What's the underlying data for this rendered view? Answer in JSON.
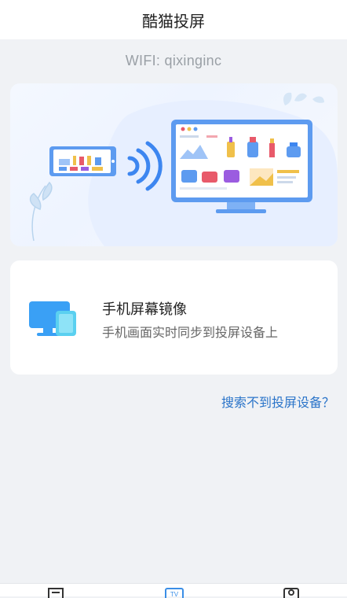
{
  "header": {
    "title": "酷猫投屏"
  },
  "wifi": {
    "text": "WIFI: qixinginc"
  },
  "banner": {
    "illustration": "phone-cast-to-monitor"
  },
  "mirror_card": {
    "icon": "screen-mirror-icon",
    "title": "手机屏幕镜像",
    "description": "手机画面实时同步到投屏设备上"
  },
  "help_link": {
    "text": "搜索不到投屏设备？"
  },
  "tabbar": {
    "tabs": [
      {
        "icon": "document-icon"
      },
      {
        "icon": "tv-icon",
        "label": "TV",
        "active": true
      },
      {
        "icon": "profile-icon"
      }
    ]
  },
  "colors": {
    "accent": "#2a74c9",
    "tab_active": "#3a8ee6",
    "background": "#f0f2f5"
  }
}
